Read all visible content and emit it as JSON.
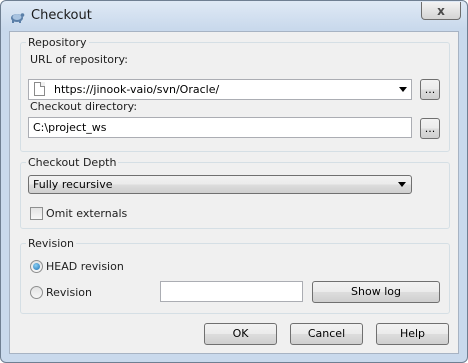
{
  "window": {
    "title": "Checkout",
    "close_label": "x"
  },
  "repository": {
    "group_label": "Repository",
    "url_label": "URL of repository:",
    "url_value": "https://jinook-vaio/svn/Oracle/",
    "browse_label": "...",
    "dir_label": "Checkout directory:",
    "dir_value": "C:\\project_ws",
    "dir_browse_label": "..."
  },
  "depth": {
    "group_label": "Checkout Depth",
    "selected": "Fully recursive",
    "omit_externals_label": "Omit externals",
    "omit_externals_checked": false
  },
  "revision": {
    "group_label": "Revision",
    "head_label": "HEAD revision",
    "revision_label": "Revision",
    "revision_value": "",
    "show_log_label": "Show log",
    "selected": "head"
  },
  "buttons": {
    "ok": "OK",
    "cancel": "Cancel",
    "help": "Help"
  }
}
